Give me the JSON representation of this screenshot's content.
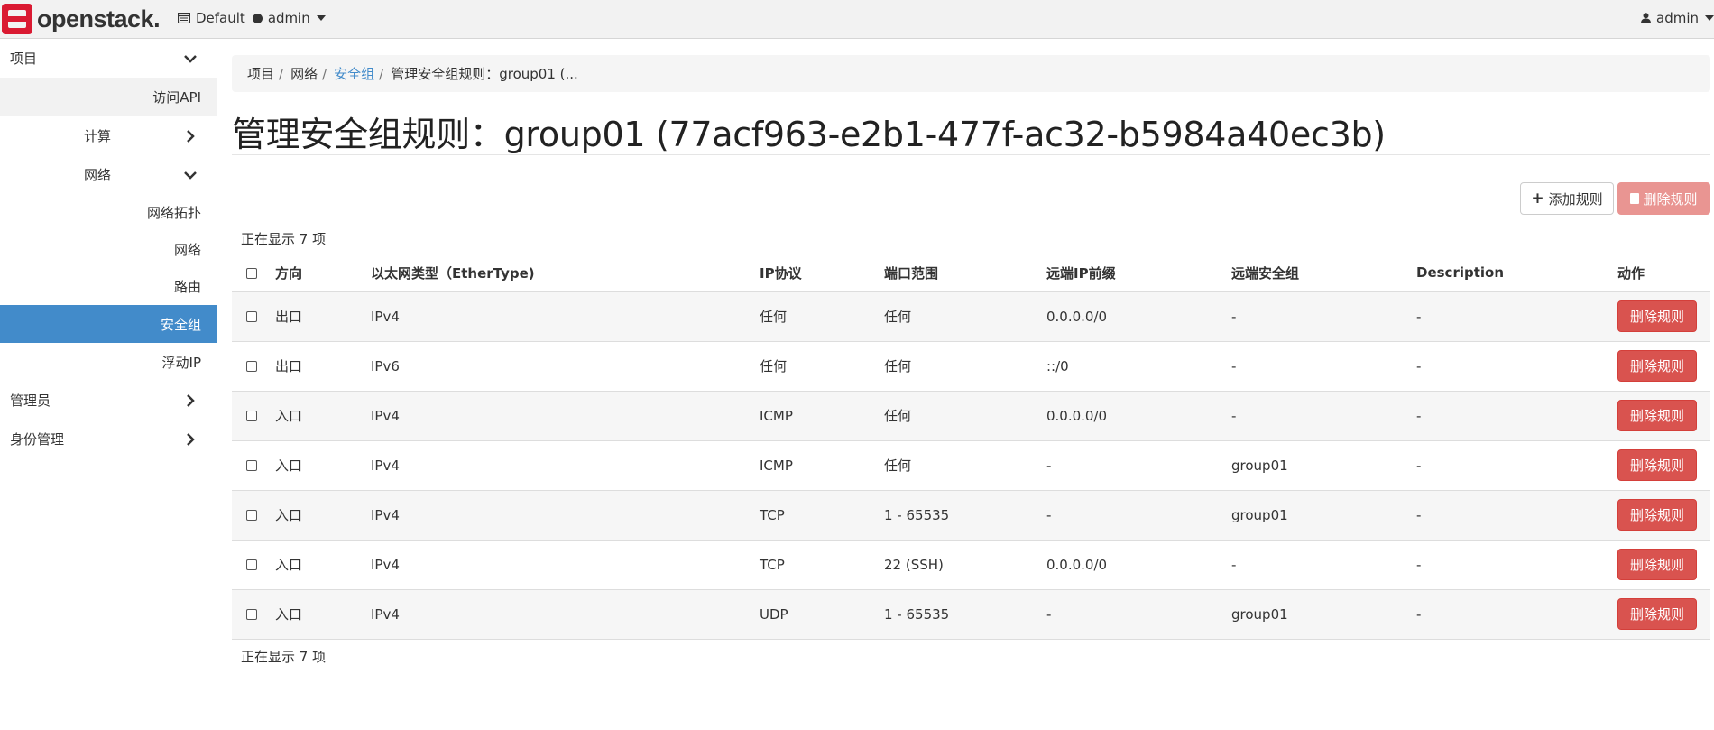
{
  "topbar": {
    "brand": "openstack",
    "brand_mark": ".",
    "domain": "Default",
    "project": "admin",
    "user": "admin"
  },
  "sidebar": {
    "items": [
      {
        "label": "项目",
        "level": 1,
        "chevron": "chevron-down-icon"
      },
      {
        "label": "访问API",
        "level": 3
      },
      {
        "label": "计算",
        "level": 2,
        "chevron": "chevron-right-icon"
      },
      {
        "label": "网络",
        "level": 2,
        "chevron": "chevron-down-icon"
      },
      {
        "label": "网络拓扑",
        "level": 3
      },
      {
        "label": "网络",
        "level": 3
      },
      {
        "label": "路由",
        "level": 3
      },
      {
        "label": "安全组",
        "level": 3,
        "active": true
      },
      {
        "label": "浮动IP",
        "level": 3
      },
      {
        "label": "管理员",
        "level": 1,
        "chevron": "chevron-right-icon"
      },
      {
        "label": "身份管理",
        "level": 1,
        "chevron": "chevron-right-icon"
      }
    ],
    "active_color": "#428bca"
  },
  "breadcrumb": {
    "items": [
      "项目",
      "网络",
      "安全组",
      "管理安全组规则：group01 (..."
    ]
  },
  "page": {
    "title": "管理安全组规则：group01 (77acf963-e2b1-477f-ac32-b5984a40ec3b)"
  },
  "actions": {
    "add_label": "添加规则",
    "delete_all_label": "删除规则"
  },
  "table": {
    "count_top": "正在显示 7 项",
    "count_bottom": "正在显示 7 项",
    "columns": [
      "方向",
      "以太网类型（EtherType)",
      "IP协议",
      "端口范围",
      "远端IP前缀",
      "远端安全组",
      "Description",
      "动作"
    ],
    "rows": [
      {
        "direction": "出口",
        "ethertype": "IPv4",
        "protocol": "任何",
        "port": "任何",
        "remote_ip": "0.0.0.0/0",
        "remote_group": "-",
        "description": "-",
        "action": "删除规则"
      },
      {
        "direction": "出口",
        "ethertype": "IPv6",
        "protocol": "任何",
        "port": "任何",
        "remote_ip": "::/0",
        "remote_group": "-",
        "description": "-",
        "action": "删除规则"
      },
      {
        "direction": "入口",
        "ethertype": "IPv4",
        "protocol": "ICMP",
        "port": "任何",
        "remote_ip": "0.0.0.0/0",
        "remote_group": "-",
        "description": "-",
        "action": "删除规则"
      },
      {
        "direction": "入口",
        "ethertype": "IPv4",
        "protocol": "ICMP",
        "port": "任何",
        "remote_ip": "-",
        "remote_group": "group01",
        "description": "-",
        "action": "删除规则"
      },
      {
        "direction": "入口",
        "ethertype": "IPv4",
        "protocol": "TCP",
        "port": "1 - 65535",
        "remote_ip": "-",
        "remote_group": "group01",
        "description": "-",
        "action": "删除规则"
      },
      {
        "direction": "入口",
        "ethertype": "IPv4",
        "protocol": "TCP",
        "port": "22 (SSH)",
        "remote_ip": "0.0.0.0/0",
        "remote_group": "-",
        "description": "-",
        "action": "删除规则"
      },
      {
        "direction": "入口",
        "ethertype": "IPv4",
        "protocol": "UDP",
        "port": "1 - 65535",
        "remote_ip": "-",
        "remote_group": "group01",
        "description": "-",
        "action": "删除规则"
      }
    ]
  },
  "colors": {
    "danger": "#d9534f",
    "danger_disabled": "#e99592",
    "link": "#428bca",
    "brand_red": "#da1a32"
  }
}
